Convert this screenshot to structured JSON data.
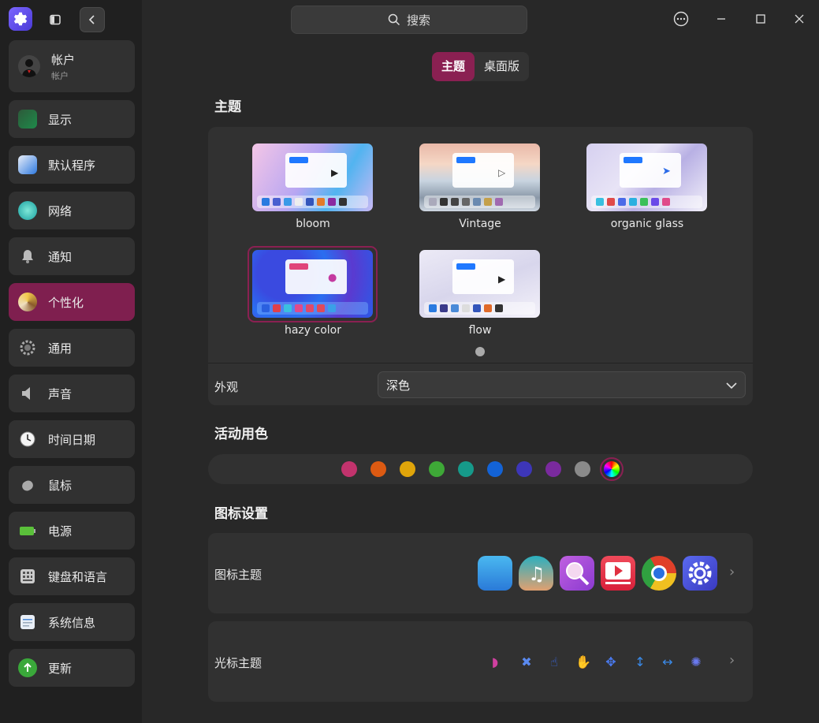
{
  "search": {
    "label": "搜索"
  },
  "sidebar": {
    "account": {
      "title": "帐户",
      "subtitle": "帐户"
    },
    "items": [
      {
        "label": "显示"
      },
      {
        "label": "默认程序"
      },
      {
        "label": "网络"
      },
      {
        "label": "通知"
      },
      {
        "label": "个性化"
      },
      {
        "label": "通用"
      },
      {
        "label": "声音"
      },
      {
        "label": "时间日期"
      },
      {
        "label": "鼠标"
      },
      {
        "label": "电源"
      },
      {
        "label": "键盘和语言"
      },
      {
        "label": "系统信息"
      },
      {
        "label": "更新"
      }
    ]
  },
  "tabs": [
    {
      "label": "主题"
    },
    {
      "label": "桌面版"
    }
  ],
  "sections": {
    "theme_title": "主题",
    "accent_title": "活动用色",
    "icon_settings_title": "图标设置"
  },
  "themes": [
    {
      "name": "bloom"
    },
    {
      "name": "Vintage"
    },
    {
      "name": "organic glass"
    },
    {
      "name": "hazy color"
    },
    {
      "name": "flow"
    }
  ],
  "appearance": {
    "label": "外观",
    "value": "深色"
  },
  "accent_colors": [
    "#c2336d",
    "#dc5a12",
    "#e0a50a",
    "#3ea837",
    "#169a8a",
    "#1363d6",
    "#3d36b8",
    "#7a2a9e",
    "#8a8a8a",
    "multicolor"
  ],
  "icon_theme": {
    "label": "图标主题"
  },
  "cursor_theme": {
    "label": "光标主题"
  },
  "colors": {
    "accent": "#7f1f4f",
    "selected_theme_border": "#8a2052"
  }
}
